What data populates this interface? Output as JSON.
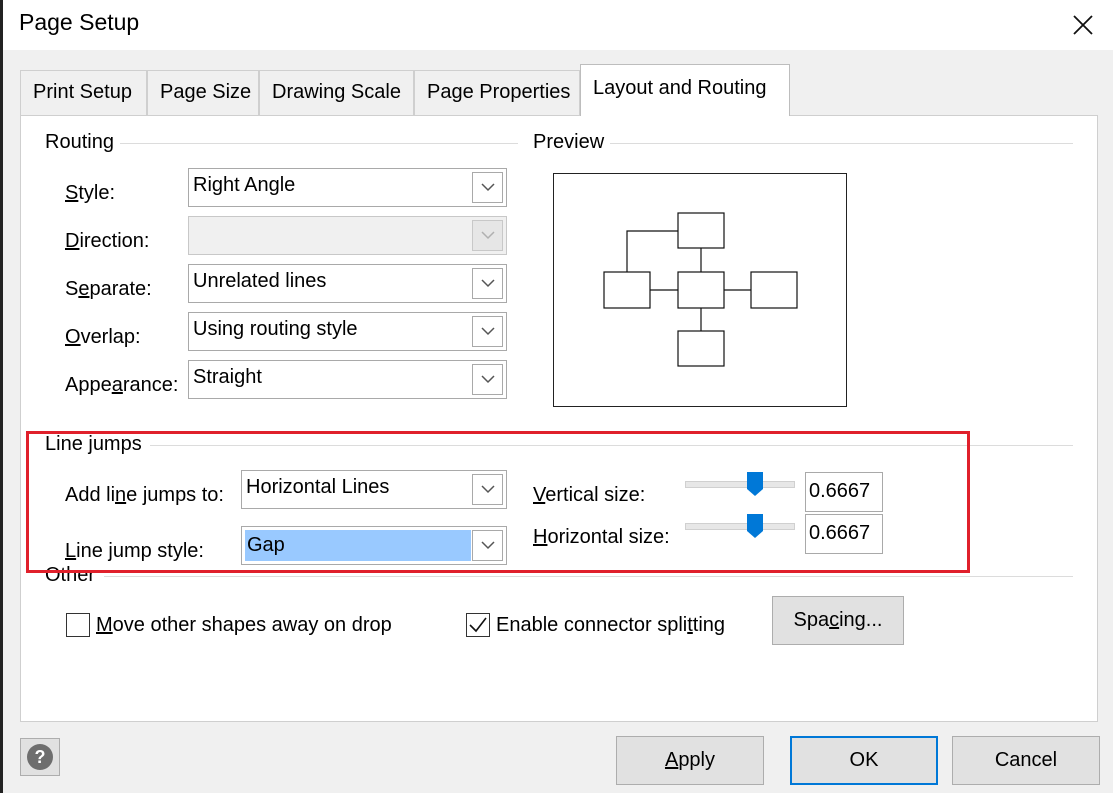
{
  "window": {
    "title": "Page Setup",
    "close_icon": "close-icon"
  },
  "tabs": [
    {
      "label": "Print Setup",
      "active": false
    },
    {
      "label": "Page Size",
      "active": false
    },
    {
      "label": "Drawing Scale",
      "active": false
    },
    {
      "label": "Page Properties",
      "active": false
    },
    {
      "label": "Layout and Routing",
      "active": true
    }
  ],
  "routing": {
    "section_label": "Routing",
    "style": {
      "label": "Style:",
      "value": "Right Angle"
    },
    "direction": {
      "label": "Direction:",
      "value": "",
      "disabled": true
    },
    "separate": {
      "label": "Separate:",
      "value": "Unrelated lines"
    },
    "overlap": {
      "label": "Overlap:",
      "value": "Using routing style"
    },
    "appearance": {
      "label": "Appearance:",
      "value": "Straight"
    }
  },
  "preview": {
    "section_label": "Preview"
  },
  "line_jumps": {
    "section_label": "Line jumps",
    "add_to": {
      "label": "Add line jumps to:",
      "value": "Horizontal Lines"
    },
    "style": {
      "label": "Line jump style:",
      "value": "Gap"
    },
    "vertical_size": {
      "label": "Vertical size:",
      "value": "0.6667",
      "slider_fraction": 0.64
    },
    "horizontal_size": {
      "label": "Horizontal size:",
      "value": "0.6667",
      "slider_fraction": 0.64
    }
  },
  "other": {
    "section_label": "Other",
    "move_shapes": {
      "label": "Move other shapes away on drop",
      "checked": false
    },
    "connector_splitting": {
      "label": "Enable connector splitting",
      "checked": true
    },
    "spacing_button": "Spacing..."
  },
  "footer": {
    "help_icon": "help-icon",
    "apply": "Apply",
    "ok": "OK",
    "cancel": "Cancel"
  },
  "colors": {
    "accent": "#0078d7",
    "highlight": "#e0202b",
    "selection": "#99c9ff"
  }
}
